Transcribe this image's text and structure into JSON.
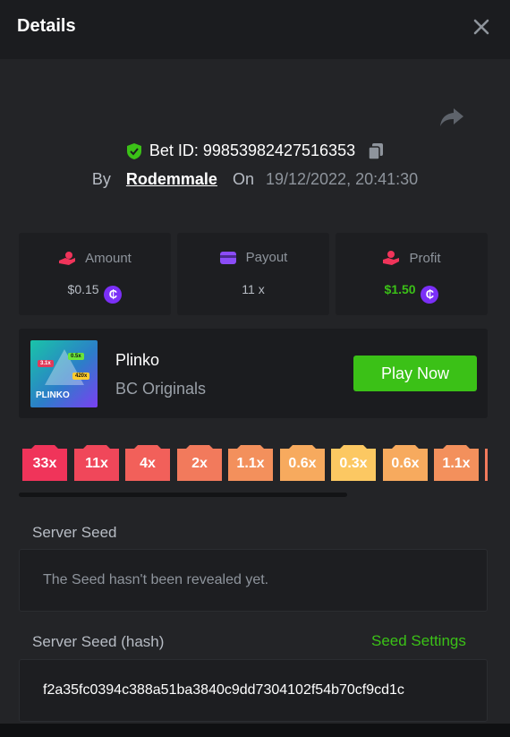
{
  "header": {
    "title": "Details"
  },
  "bet": {
    "id_label": "Bet ID: 99853982427516353",
    "by_label": "By",
    "user": "Rodemmale",
    "on_label": "On",
    "datetime": "19/12/2022, 20:41:30"
  },
  "stats": {
    "amount": {
      "label": "Amount",
      "value": "$0.15"
    },
    "payout": {
      "label": "Payout",
      "value": "11 x"
    },
    "profit": {
      "label": "Profit",
      "value": "$1.50"
    },
    "coin_symbol": "₵"
  },
  "game": {
    "name": "Plinko",
    "provider": "BC Originals",
    "play_label": "Play Now",
    "thumb_tags": [
      "3.1x",
      "0.5x",
      "420x"
    ],
    "thumb_name": "PLINKO"
  },
  "multipliers": [
    "33x",
    "11x",
    "4x",
    "2x",
    "1.1x",
    "0.6x",
    "0.3x",
    "0.6x",
    "1.1x"
  ],
  "seed": {
    "server_seed_label": "Server Seed",
    "server_seed_value": "The Seed hasn't been revealed yet.",
    "hash_label": "Server Seed (hash)",
    "settings_label": "Seed Settings",
    "hash_value": "f2a35fc0394c388a51ba3840c9dd7304102f54b70cf9cd1c"
  },
  "colors": {
    "accent_green": "#3bc117",
    "coin_purple": "#7b2ff7",
    "multiplier_colors": [
      "#f0345a",
      "#f0475a",
      "#f2605a",
      "#f27a5c",
      "#f3905c",
      "#f7aa5e",
      "#fcc862",
      "#f7aa5e",
      "#f3905c"
    ]
  },
  "icons": [
    "close-icon",
    "share-icon",
    "shield-check-icon",
    "copy-icon",
    "amount-icon",
    "payout-card-icon",
    "profit-icon",
    "coin-icon"
  ]
}
